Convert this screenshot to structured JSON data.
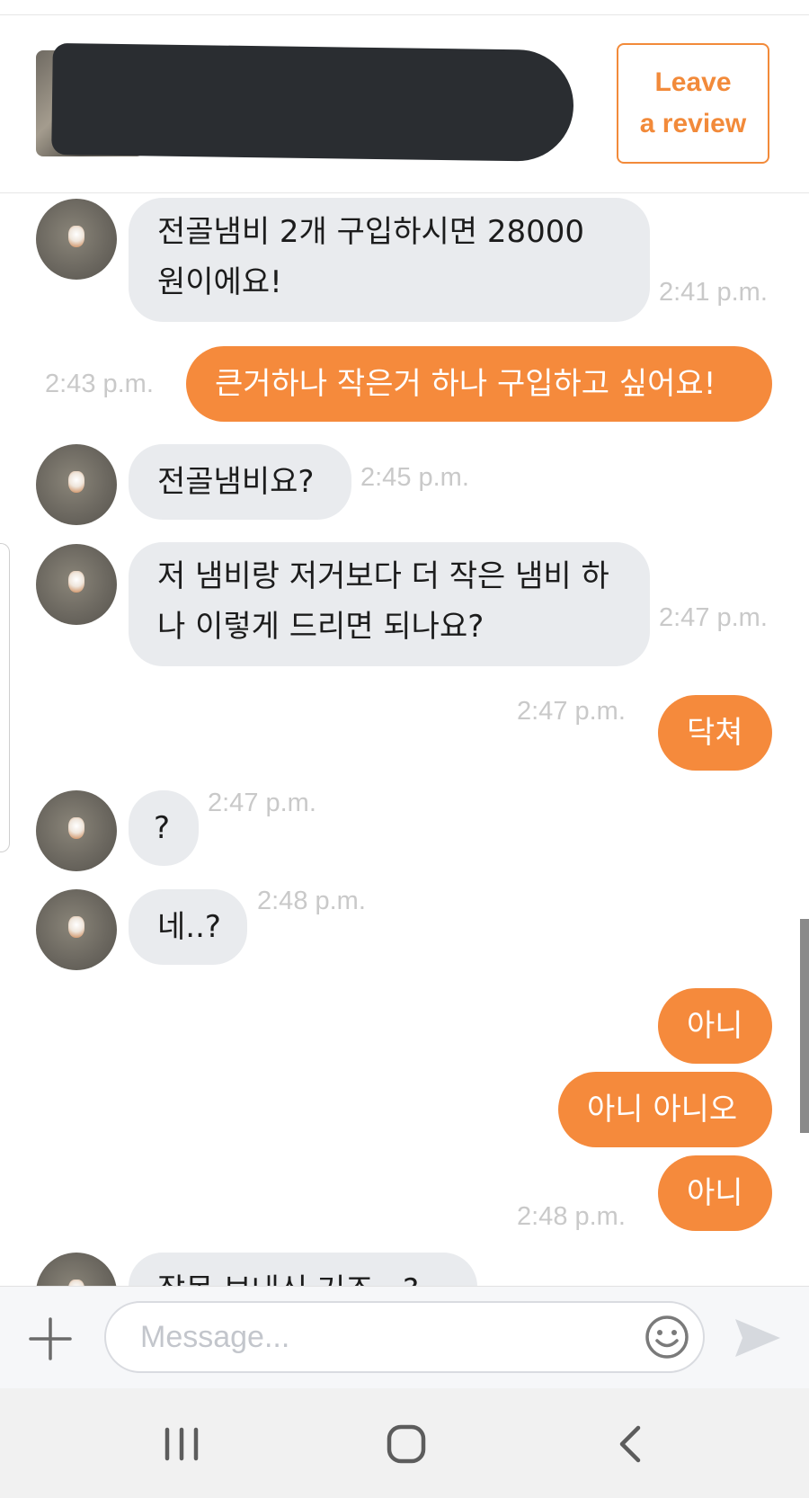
{
  "header": {
    "review_line1": "Leave",
    "review_line2": "a review"
  },
  "messages": [
    {
      "from": "them",
      "text": "전골냄비 2개 구입하시면 28000 원이에요!",
      "time": "2:41 p.m."
    },
    {
      "from": "me",
      "text": "큰거하나 작은거 하나 구입하고 싶어요!",
      "time": "2:43 p.m."
    },
    {
      "from": "them",
      "text": "전골냄비요?",
      "time": "2:45 p.m."
    },
    {
      "from": "them",
      "text": "저 냄비랑 저거보다 더 작은 냄비 하나 이렇게 드리면 되나요?",
      "time": "2:47 p.m."
    },
    {
      "from": "me",
      "text": "닥쳐",
      "time": "2:47 p.m."
    },
    {
      "from": "them",
      "text": "?",
      "time": "2:47 p.m."
    },
    {
      "from": "them",
      "text": "네..?",
      "time": "2:48 p.m."
    },
    {
      "from": "me",
      "text": "아니",
      "time": ""
    },
    {
      "from": "me",
      "text": "아니 아니오",
      "time": ""
    },
    {
      "from": "me",
      "text": "아니",
      "time": "2:48 p.m."
    },
    {
      "from": "them",
      "text": "잘못 보내신 거죠...?",
      "time": ""
    }
  ],
  "composer": {
    "placeholder": "Message...",
    "value": ""
  },
  "colors": {
    "accent": "#f58a3c",
    "incoming_bubble": "#e9ebee",
    "timestamp": "#c9c9c9"
  },
  "icons": [
    "plus-icon",
    "emoji-icon",
    "send-icon",
    "recent-apps-icon",
    "home-icon",
    "back-icon"
  ]
}
